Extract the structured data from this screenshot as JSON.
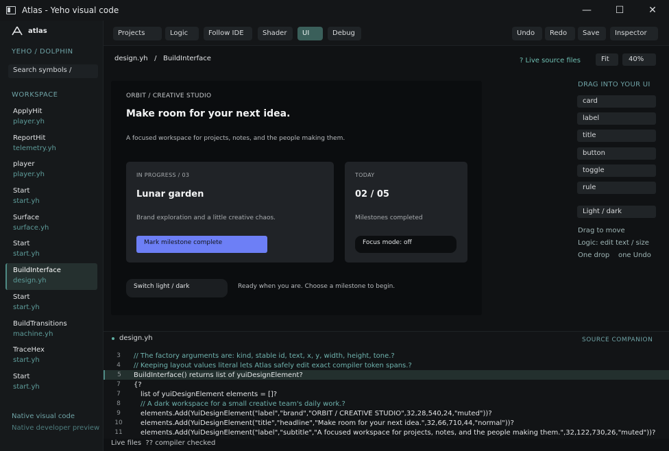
{
  "window": {
    "title": "Atlas - Yeho visual code",
    "controls": {
      "minimize": "—",
      "maximize": "☐",
      "close": "✕"
    }
  },
  "sidebar": {
    "brand": "atlas",
    "project_path": "YEHO / DOLPHIN",
    "search_placeholder": "Search symbols  /",
    "section": "WORKSPACE",
    "items": [
      {
        "name": "ApplyHit",
        "file": "player.yh"
      },
      {
        "name": "ReportHit",
        "file": "telemetry.yh"
      },
      {
        "name": "player",
        "file": "player.yh"
      },
      {
        "name": "Start",
        "file": "start.yh"
      },
      {
        "name": "Surface",
        "file": "surface.yh"
      },
      {
        "name": "Start",
        "file": "start.yh"
      },
      {
        "name": "BuildInterface",
        "file": "design.yh",
        "active": true
      },
      {
        "name": "Start",
        "file": "start.yh"
      },
      {
        "name": "BuildTransitions",
        "file": "machine.yh"
      },
      {
        "name": "TraceHex",
        "file": "start.yh"
      },
      {
        "name": "Start",
        "file": "start.yh"
      }
    ],
    "footer": {
      "link1": "Native visual code",
      "link2": "Native developer preview"
    }
  },
  "toolbar": {
    "left": [
      "Projects",
      "Logic",
      "Follow IDE",
      "Shader",
      "UI",
      "Debug"
    ],
    "active": "UI",
    "right": [
      "Undo",
      "Redo",
      "Save",
      "Inspector"
    ]
  },
  "editor": {
    "breadcrumb": "design.yh   /   BuildInterface",
    "live_files": "?  Live source files",
    "fit": "Fit",
    "zoom": "40%"
  },
  "canvas": {
    "brand": "ORBIT / CREATIVE STUDIO",
    "headline": "Make room for your next idea.",
    "subtitle": "A focused workspace for projects, notes, and the people making them.",
    "card_a": {
      "label": "IN PROGRESS / 03",
      "title": "Lunar garden",
      "text": "Brand exploration and a little creative chaos.",
      "button": "Mark milestone complete"
    },
    "card_b": {
      "label": "TODAY",
      "title": "02 / 05",
      "text": "Milestones completed",
      "toggle": "Focus mode: off"
    },
    "switch_button": "Switch light / dark",
    "status": "Ready when you are. Choose a milestone to begin."
  },
  "palette": {
    "title": "DRAG INTO YOUR UI",
    "items": [
      "card",
      "label",
      "title",
      "button",
      "toggle",
      "rule"
    ],
    "theme": "Light / dark",
    "notes": [
      "Drag to move",
      "Logic: edit text / size",
      "One drop    one Undo"
    ]
  },
  "code": {
    "tab": "design.yh",
    "companion": "SOURCE COMPANION",
    "lines": [
      {
        "n": "3",
        "indent": 2,
        "kind": "comment",
        "text": "// The factory arguments are: kind, stable id, text, x, y, width, height, tone.?"
      },
      {
        "n": "4",
        "indent": 2,
        "kind": "comment",
        "text": "// Keeping layout values literal lets Atlas safely edit exact compiler token spans.?"
      },
      {
        "n": "5",
        "indent": 2,
        "kind": "code",
        "text": "BuildInterface() returns list of yuiDesignElement?",
        "hl": true
      },
      {
        "n": "7",
        "indent": 2,
        "kind": "code",
        "text": "{?"
      },
      {
        "n": "7",
        "indent": 5,
        "kind": "code",
        "text": "list of yuiDesignElement elements = []?"
      },
      {
        "n": "8",
        "indent": 5,
        "kind": "comment",
        "text": "// A dark workspace for a small creative team's daily work.?"
      },
      {
        "n": "9",
        "indent": 5,
        "kind": "code",
        "text": "elements.Add(YuiDesignElement(\"label\",\"brand\",\"ORBIT / CREATIVE STUDIO\",32,28,540,24,\"muted\"))?"
      },
      {
        "n": "10",
        "indent": 5,
        "kind": "code",
        "text": "elements.Add(YuiDesignElement(\"title\",\"headline\",\"Make room for your next idea.\",32,66,710,44,\"normal\"))?"
      },
      {
        "n": "11",
        "indent": 5,
        "kind": "code",
        "text": "elements.Add(YuiDesignElement(\"label\",\"subtitle\",\"A focused workspace for projects, notes, and the people making them.\",32,122,730,26,\"muted\"))?"
      }
    ]
  },
  "status_bar": "Live files  ?? compiler checked",
  "colors": {
    "accent": "#6d7ff6",
    "teal": "#6fa3a6",
    "active_tab": "#3a5f5a"
  }
}
